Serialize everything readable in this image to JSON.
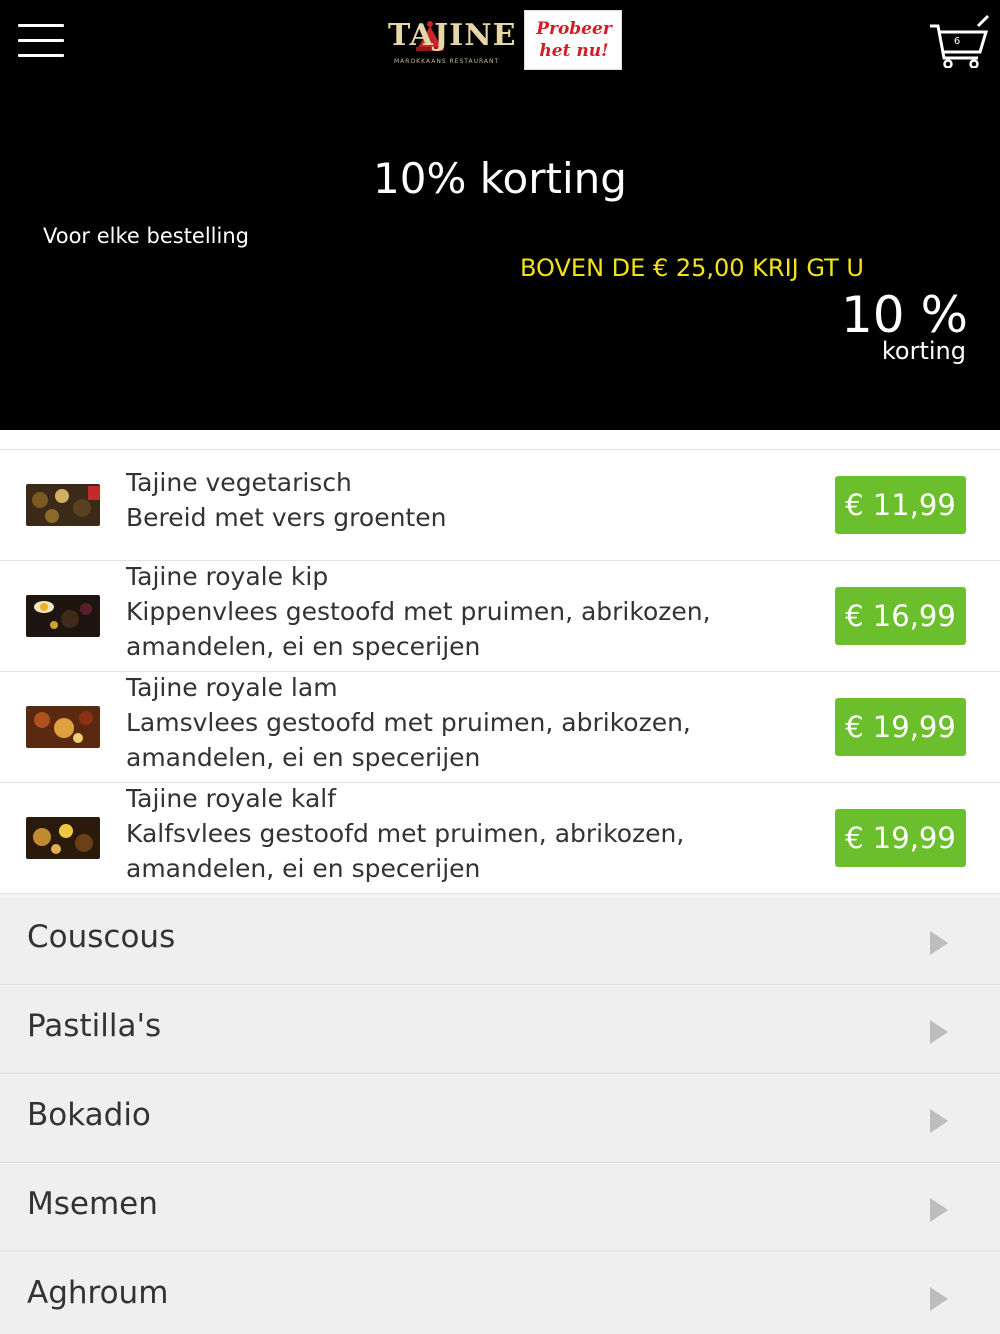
{
  "header": {
    "logo": {
      "text": "TAJINE",
      "subtitle": "MAROKKAANS RESTAURANT"
    },
    "promo_badge": {
      "line1": "Probeer",
      "line2": "het nu!"
    },
    "cart": {
      "count": "6"
    }
  },
  "promo": {
    "title": "10% korting",
    "left_text": "Voor elke bestelling",
    "yellow_text": "BOVEN DE € 25,00 KRIJ GT U",
    "big_text": "10 %",
    "small_text": "korting"
  },
  "items": [
    {
      "name": "Tajine vegetarisch",
      "desc_line1": "Bereid met vers groenten",
      "desc_line2": "",
      "price": "€ 11,99"
    },
    {
      "name": "Tajine royale kip",
      "desc_line1": "Kippenvlees gestoofd met pruimen, abrikozen,",
      "desc_line2": "amandelen, ei en specerijen",
      "price": "€ 16,99"
    },
    {
      "name": "Tajine royale lam",
      "desc_line1": "Lamsvlees gestoofd met pruimen, abrikozen,",
      "desc_line2": "amandelen, ei en specerijen",
      "price": "€ 19,99"
    },
    {
      "name": "Tajine royale kalf",
      "desc_line1": "Kalfsvlees gestoofd met pruimen, abrikozen,",
      "desc_line2": "amandelen, ei en specerijen",
      "price": "€ 19,99"
    }
  ],
  "categories": [
    {
      "label": "Couscous"
    },
    {
      "label": "Pastilla's"
    },
    {
      "label": "Bokadio"
    },
    {
      "label": "Msemen"
    },
    {
      "label": "Aghroum"
    }
  ],
  "colors": {
    "header_bg": "#000000",
    "price_green": "#6bbf2d",
    "promo_yellow": "#f2e21a",
    "badge_red": "#d41c24"
  }
}
